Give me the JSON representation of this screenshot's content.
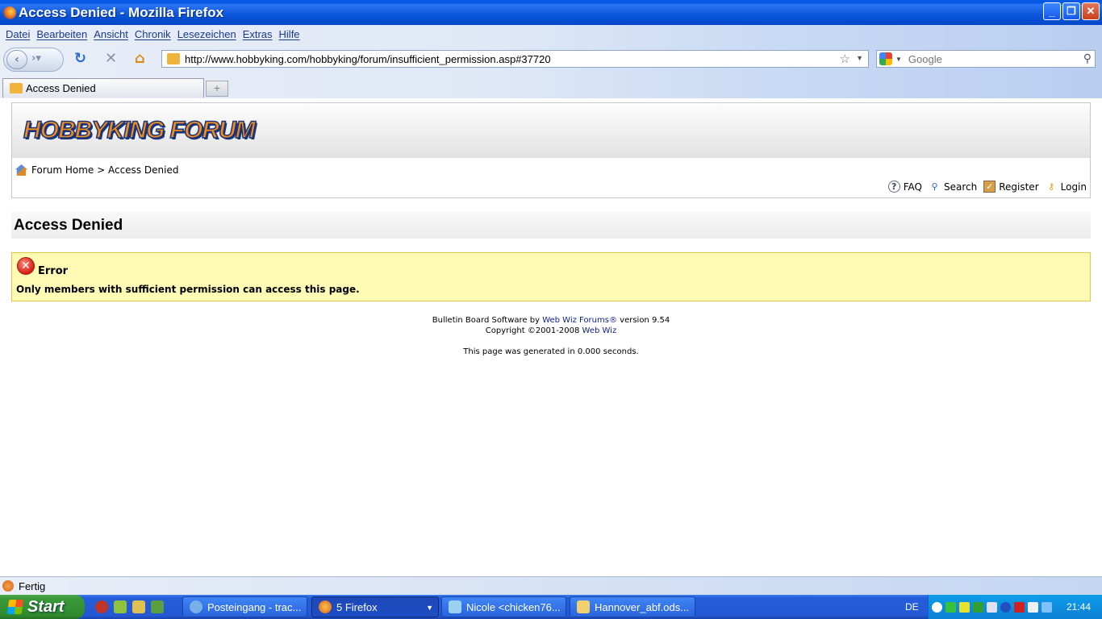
{
  "window": {
    "title": "Access Denied - Mozilla Firefox"
  },
  "menu": [
    "Datei",
    "Bearbeiten",
    "Ansicht",
    "Chronik",
    "Lesezeichen",
    "Extras",
    "Hilfe"
  ],
  "address": {
    "url": "http://www.hobbyking.com/hobbyking/forum/insufficient_permission.asp#37720"
  },
  "search": {
    "placeholder": "Google"
  },
  "tab": {
    "label": "Access Denied"
  },
  "forum": {
    "logo": "HOBBYKING FORUM",
    "breadcrumb_home": "Forum Home",
    "breadcrumb_sep": " > ",
    "breadcrumb_current": "Access Denied",
    "links": {
      "faq": "FAQ",
      "search": "Search",
      "register": "Register",
      "login": "Login"
    }
  },
  "page": {
    "title": "Access Denied",
    "error_title": "Error",
    "error_message": "Only members with sufficient permission can access this page."
  },
  "footer": {
    "line1_pre": "Bulletin Board Software by ",
    "line1_link": "Web Wiz Forums®",
    "line1_post": " version 9.54",
    "line2_pre": "Copyright ©2001-2008 ",
    "line2_link": "Web Wiz",
    "generated": "This page was generated in 0.000 seconds."
  },
  "status": {
    "text": "Fertig"
  },
  "taskbar": {
    "start": "Start",
    "tasks": [
      {
        "label": "Posteingang - trac...",
        "active": false
      },
      {
        "label": "5 Firefox",
        "active": true
      },
      {
        "label": "Nicole <chicken76...",
        "active": false
      },
      {
        "label": "Hannover_abf.ods...",
        "active": false
      }
    ],
    "language": "DE",
    "clock": "21:44"
  },
  "colors": {
    "link": "#0b1f8a",
    "error_bg": "#fffbb5",
    "logo_orange": "#f48a1a",
    "logo_navy": "#17357c"
  },
  "icons": [
    "firefox-icon",
    "minimize-icon",
    "maximize-icon",
    "close-icon",
    "back-icon",
    "forward-icon",
    "reload-icon",
    "stop-icon",
    "home-icon",
    "bookmark-star-icon",
    "google-icon",
    "magnifier-icon",
    "forum-home-icon",
    "faq-icon",
    "search-icon",
    "register-icon",
    "key-icon",
    "error-icon",
    "windows-flag-icon"
  ]
}
